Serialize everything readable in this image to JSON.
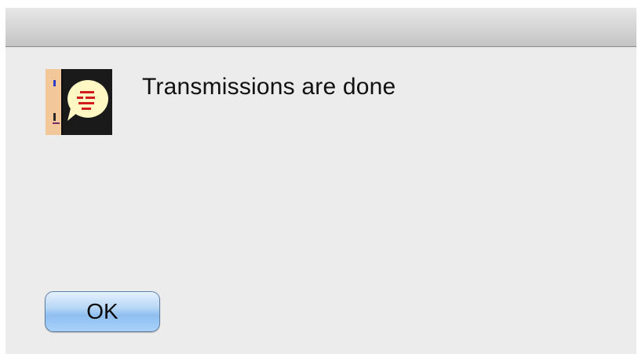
{
  "dialog": {
    "message": "Transmissions are done",
    "icon": "speech-bubble-face-icon",
    "ok_label": "OK"
  }
}
